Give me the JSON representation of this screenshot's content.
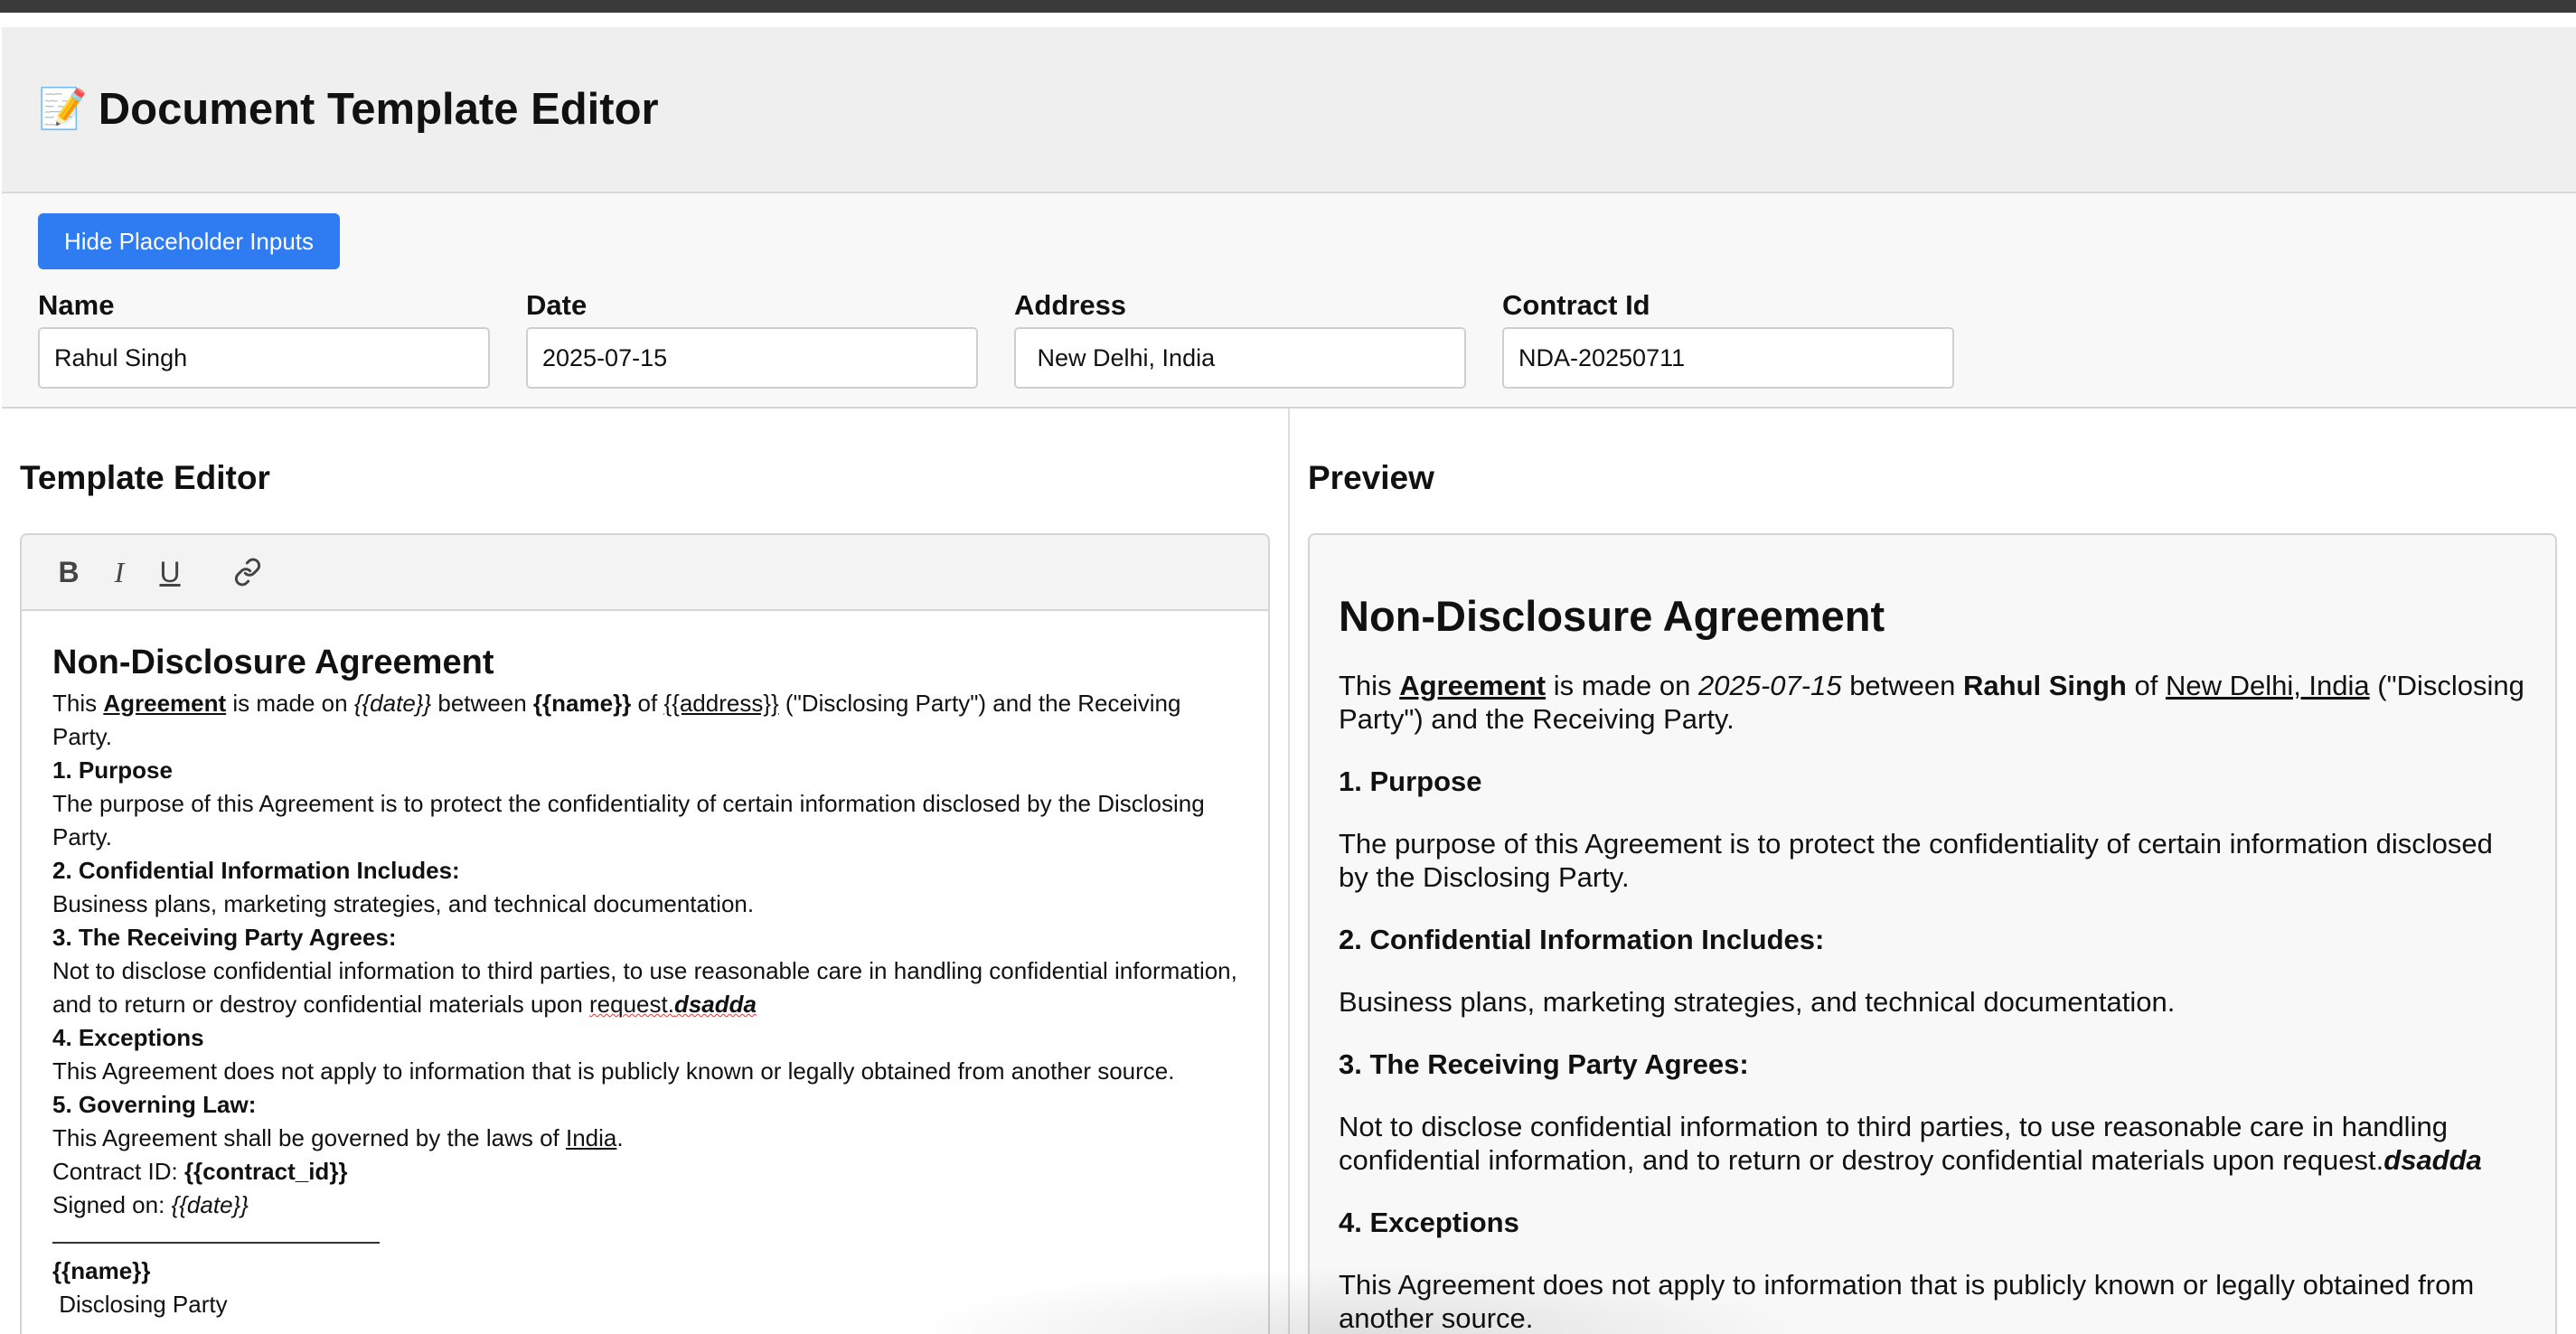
{
  "app": {
    "title": "Document Template Editor",
    "title_icon": "📝"
  },
  "placeholders": {
    "toggle_label": "Hide Placeholder Inputs",
    "fields": [
      {
        "label": "Name",
        "value": "Rahul Singh"
      },
      {
        "label": "Date",
        "value": "2025-07-15"
      },
      {
        "label": "Address",
        "value": " New Delhi, India"
      },
      {
        "label": "Contract Id",
        "value": "NDA-20250711"
      }
    ]
  },
  "editor": {
    "title": "Template Editor",
    "toolbar": {
      "bold": "B",
      "italic": "I",
      "underline": "U",
      "link_icon": "link-icon"
    },
    "doc_title": "Non-Disclosure Agreement",
    "intro": {
      "t1": "This ",
      "agreement": "Agreement",
      "t2": " is made on ",
      "date_ph": "{{date}}",
      "t3": " between ",
      "name_ph": "{{name}}",
      "t4": " of ",
      "address_ph": "{{address}}",
      "t5": " (\"Disclosing Party\") and the Receiving Party."
    },
    "s1_head": "1. Purpose",
    "s1_body": "The purpose of this Agreement is to protect the confidentiality of certain information disclosed by the Disclosing Party.",
    "s2_head": "2. Confidential Information Includes:",
    "s2_body": "Business plans, marketing strategies, and technical documentation.",
    "s3_head": "3. The Receiving Party Agrees:",
    "s3_body": "Not to disclose confidential information to third parties, to use reasonable care in handling confidential information, and to return or destroy confidential materials upon ",
    "s3_request": "request.",
    "s3_extra": "dsadda",
    "s4_head": "4. Exceptions",
    "s4_body": "This Agreement does not apply to information that is publicly known or legally obtained from another source.",
    "s5_head": "5. Governing Law:",
    "s5_body": "This Agreement shall be governed by the laws of ",
    "s5_country": "India",
    "s5_end": ".",
    "contract_label": "Contract ID: ",
    "contract_ph": "{{contract_id}}",
    "signed_label": "Signed on: ",
    "signed_ph": "{{date}}",
    "sig_name": "{{name}}",
    "sig_role": " Disclosing Party"
  },
  "preview": {
    "title": "Preview",
    "doc_title": "Non-Disclosure Agreement",
    "intro": {
      "t1": "This ",
      "agreement": "Agreement",
      "t2": " is made on ",
      "date": "2025-07-15",
      "t3": " between ",
      "name": "Rahul Singh",
      "t4": " of ",
      "address": "New Delhi, India",
      "t5": " (\"Disclosing Party\") and the Receiving Party."
    },
    "s1_head": "1. Purpose",
    "s1_body": "The purpose of this Agreement is to protect the confidentiality of certain information disclosed by the Disclosing Party.",
    "s2_head": "2. Confidential Information Includes:",
    "s2_body": "Business plans, marketing strategies, and technical documentation.",
    "s3_head": "3. The Receiving Party Agrees:",
    "s3_body": "Not to disclose confidential information to third parties, to use reasonable care in handling confidential information, and to return or destroy confidential materials upon request.",
    "s3_extra": "dsadda",
    "s4_head": "4. Exceptions",
    "s4_body": "This Agreement does not apply to information that is publicly known or legally obtained from another source."
  },
  "colors": {
    "accent": "#2f7bf2",
    "header_bg": "#efefef",
    "top_bar": "#3a3a3a"
  }
}
